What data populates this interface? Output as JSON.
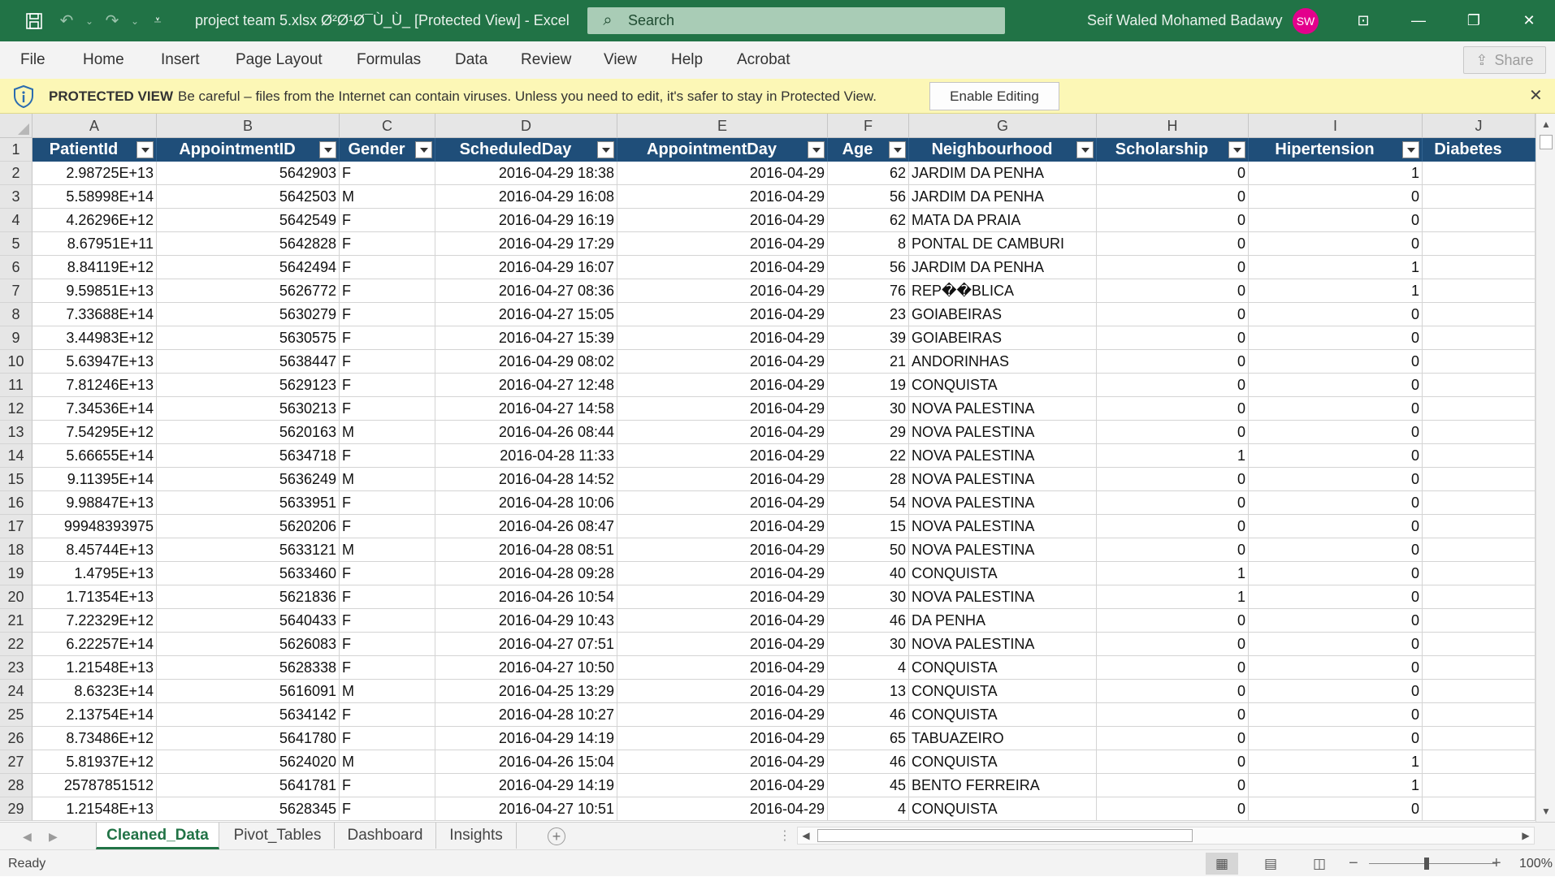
{
  "titlebar": {
    "doc_title": "project team 5.xlsx Ø²Ø¹Ø¯Ù_Ù_  [Protected View]  -  Excel",
    "search_placeholder": "Search",
    "user_name": "Seif Waled Mohamed Badawy",
    "user_initials": "SW"
  },
  "menu": {
    "tabs": [
      "File",
      "Home",
      "Insert",
      "Page Layout",
      "Formulas",
      "Data",
      "Review",
      "View",
      "Help",
      "Acrobat"
    ],
    "share_label": "Share"
  },
  "protected_bar": {
    "title": "PROTECTED VIEW",
    "message": "Be careful – files from the Internet can contain viruses. Unless you need to edit, it's safer to stay in Protected View.",
    "enable_label": "Enable Editing",
    "close_glyph": "✕"
  },
  "sheet": {
    "column_letters": [
      "A",
      "B",
      "C",
      "D",
      "E",
      "F",
      "G",
      "H",
      "I",
      "J"
    ],
    "headers": [
      "PatientId",
      "AppointmentID",
      "Gender",
      "ScheduledDay",
      "AppointmentDay",
      "Age",
      "Neighbourhood",
      "Scholarship",
      "Hipertension",
      "Diabetes"
    ],
    "row_numbers": [
      "1",
      "2",
      "3",
      "4",
      "5",
      "6",
      "7",
      "8",
      "9",
      "10",
      "11",
      "12",
      "13",
      "14",
      "15",
      "16",
      "17",
      "18",
      "19",
      "20",
      "21",
      "22",
      "23",
      "24",
      "25",
      "26",
      "27",
      "28",
      "29"
    ],
    "rows": [
      [
        "2.98725E+13",
        "5642903",
        "F",
        "2016-04-29 18:38",
        "2016-04-29",
        "62",
        "JARDIM DA PENHA",
        "0",
        "1",
        ""
      ],
      [
        "5.58998E+14",
        "5642503",
        "M",
        "2016-04-29 16:08",
        "2016-04-29",
        "56",
        "JARDIM DA PENHA",
        "0",
        "0",
        ""
      ],
      [
        "4.26296E+12",
        "5642549",
        "F",
        "2016-04-29 16:19",
        "2016-04-29",
        "62",
        "MATA DA PRAIA",
        "0",
        "0",
        ""
      ],
      [
        "8.67951E+11",
        "5642828",
        "F",
        "2016-04-29 17:29",
        "2016-04-29",
        "8",
        "PONTAL DE CAMBURI",
        "0",
        "0",
        ""
      ],
      [
        "8.84119E+12",
        "5642494",
        "F",
        "2016-04-29 16:07",
        "2016-04-29",
        "56",
        "JARDIM DA PENHA",
        "0",
        "1",
        ""
      ],
      [
        "9.59851E+13",
        "5626772",
        "F",
        "2016-04-27 08:36",
        "2016-04-29",
        "76",
        "REP��BLICA",
        "0",
        "1",
        ""
      ],
      [
        "7.33688E+14",
        "5630279",
        "F",
        "2016-04-27 15:05",
        "2016-04-29",
        "23",
        "GOIABEIRAS",
        "0",
        "0",
        ""
      ],
      [
        "3.44983E+12",
        "5630575",
        "F",
        "2016-04-27 15:39",
        "2016-04-29",
        "39",
        "GOIABEIRAS",
        "0",
        "0",
        ""
      ],
      [
        "5.63947E+13",
        "5638447",
        "F",
        "2016-04-29 08:02",
        "2016-04-29",
        "21",
        "ANDORINHAS",
        "0",
        "0",
        ""
      ],
      [
        "7.81246E+13",
        "5629123",
        "F",
        "2016-04-27 12:48",
        "2016-04-29",
        "19",
        "CONQUISTA",
        "0",
        "0",
        ""
      ],
      [
        "7.34536E+14",
        "5630213",
        "F",
        "2016-04-27 14:58",
        "2016-04-29",
        "30",
        "NOVA PALESTINA",
        "0",
        "0",
        ""
      ],
      [
        "7.54295E+12",
        "5620163",
        "M",
        "2016-04-26 08:44",
        "2016-04-29",
        "29",
        "NOVA PALESTINA",
        "0",
        "0",
        ""
      ],
      [
        "5.66655E+14",
        "5634718",
        "F",
        "2016-04-28 11:33",
        "2016-04-29",
        "22",
        "NOVA PALESTINA",
        "1",
        "0",
        ""
      ],
      [
        "9.11395E+14",
        "5636249",
        "M",
        "2016-04-28 14:52",
        "2016-04-29",
        "28",
        "NOVA PALESTINA",
        "0",
        "0",
        ""
      ],
      [
        "9.98847E+13",
        "5633951",
        "F",
        "2016-04-28 10:06",
        "2016-04-29",
        "54",
        "NOVA PALESTINA",
        "0",
        "0",
        ""
      ],
      [
        "99948393975",
        "5620206",
        "F",
        "2016-04-26 08:47",
        "2016-04-29",
        "15",
        "NOVA PALESTINA",
        "0",
        "0",
        ""
      ],
      [
        "8.45744E+13",
        "5633121",
        "M",
        "2016-04-28 08:51",
        "2016-04-29",
        "50",
        "NOVA PALESTINA",
        "0",
        "0",
        ""
      ],
      [
        "1.4795E+13",
        "5633460",
        "F",
        "2016-04-28 09:28",
        "2016-04-29",
        "40",
        "CONQUISTA",
        "1",
        "0",
        ""
      ],
      [
        "1.71354E+13",
        "5621836",
        "F",
        "2016-04-26 10:54",
        "2016-04-29",
        "30",
        "NOVA PALESTINA",
        "1",
        "0",
        ""
      ],
      [
        "7.22329E+12",
        "5640433",
        "F",
        "2016-04-29 10:43",
        "2016-04-29",
        "46",
        "DA PENHA",
        "0",
        "0",
        ""
      ],
      [
        "6.22257E+14",
        "5626083",
        "F",
        "2016-04-27 07:51",
        "2016-04-29",
        "30",
        "NOVA PALESTINA",
        "0",
        "0",
        ""
      ],
      [
        "1.21548E+13",
        "5628338",
        "F",
        "2016-04-27 10:50",
        "2016-04-29",
        "4",
        "CONQUISTA",
        "0",
        "0",
        ""
      ],
      [
        "8.6323E+14",
        "5616091",
        "M",
        "2016-04-25 13:29",
        "2016-04-29",
        "13",
        "CONQUISTA",
        "0",
        "0",
        ""
      ],
      [
        "2.13754E+14",
        "5634142",
        "F",
        "2016-04-28 10:27",
        "2016-04-29",
        "46",
        "CONQUISTA",
        "0",
        "0",
        ""
      ],
      [
        "8.73486E+12",
        "5641780",
        "F",
        "2016-04-29 14:19",
        "2016-04-29",
        "65",
        "TABUAZEIRO",
        "0",
        "0",
        ""
      ],
      [
        "5.81937E+12",
        "5624020",
        "M",
        "2016-04-26 15:04",
        "2016-04-29",
        "46",
        "CONQUISTA",
        "0",
        "1",
        ""
      ],
      [
        "25787851512",
        "5641781",
        "F",
        "2016-04-29 14:19",
        "2016-04-29",
        "45",
        "BENTO FERREIRA",
        "0",
        "1",
        ""
      ],
      [
        "1.21548E+13",
        "5628345",
        "F",
        "2016-04-27 10:51",
        "2016-04-29",
        "4",
        "CONQUISTA",
        "0",
        "0",
        ""
      ]
    ]
  },
  "sheet_tabs": [
    "Cleaned_Data",
    "Pivot_Tables",
    "Dashboard",
    "Insights"
  ],
  "status": {
    "ready": "Ready",
    "zoom": "100%"
  },
  "colors": {
    "excel_green": "#217346",
    "table_header": "#1f4e79",
    "protected_bar": "#fcf7b6",
    "avatar": "#e3008c"
  },
  "icons": {
    "save": "save-icon",
    "undo": "undo-icon",
    "redo": "redo-icon",
    "search": "search-icon",
    "shield": "shield-info-icon",
    "filter": "filter-dropdown-icon"
  }
}
